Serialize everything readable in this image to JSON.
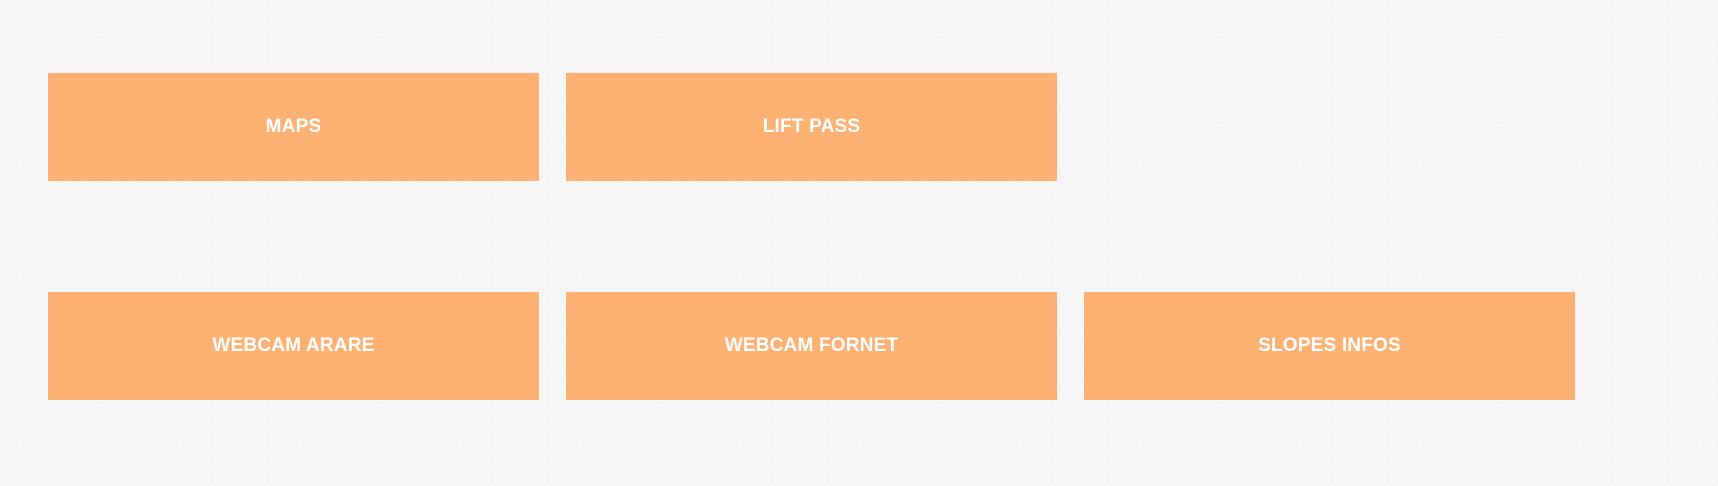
{
  "tiles": {
    "maps": "MAPS",
    "lift_pass": "LIFT PASS",
    "webcam_arare": "WEBCAM ARARE",
    "webcam_fornet": "WEBCAM FORNET",
    "slopes_infos": "SLOPES INFOS"
  },
  "colors": {
    "tile_background": "#fdb274",
    "tile_text": "#ffffff",
    "page_background": "#f6f6f6"
  }
}
